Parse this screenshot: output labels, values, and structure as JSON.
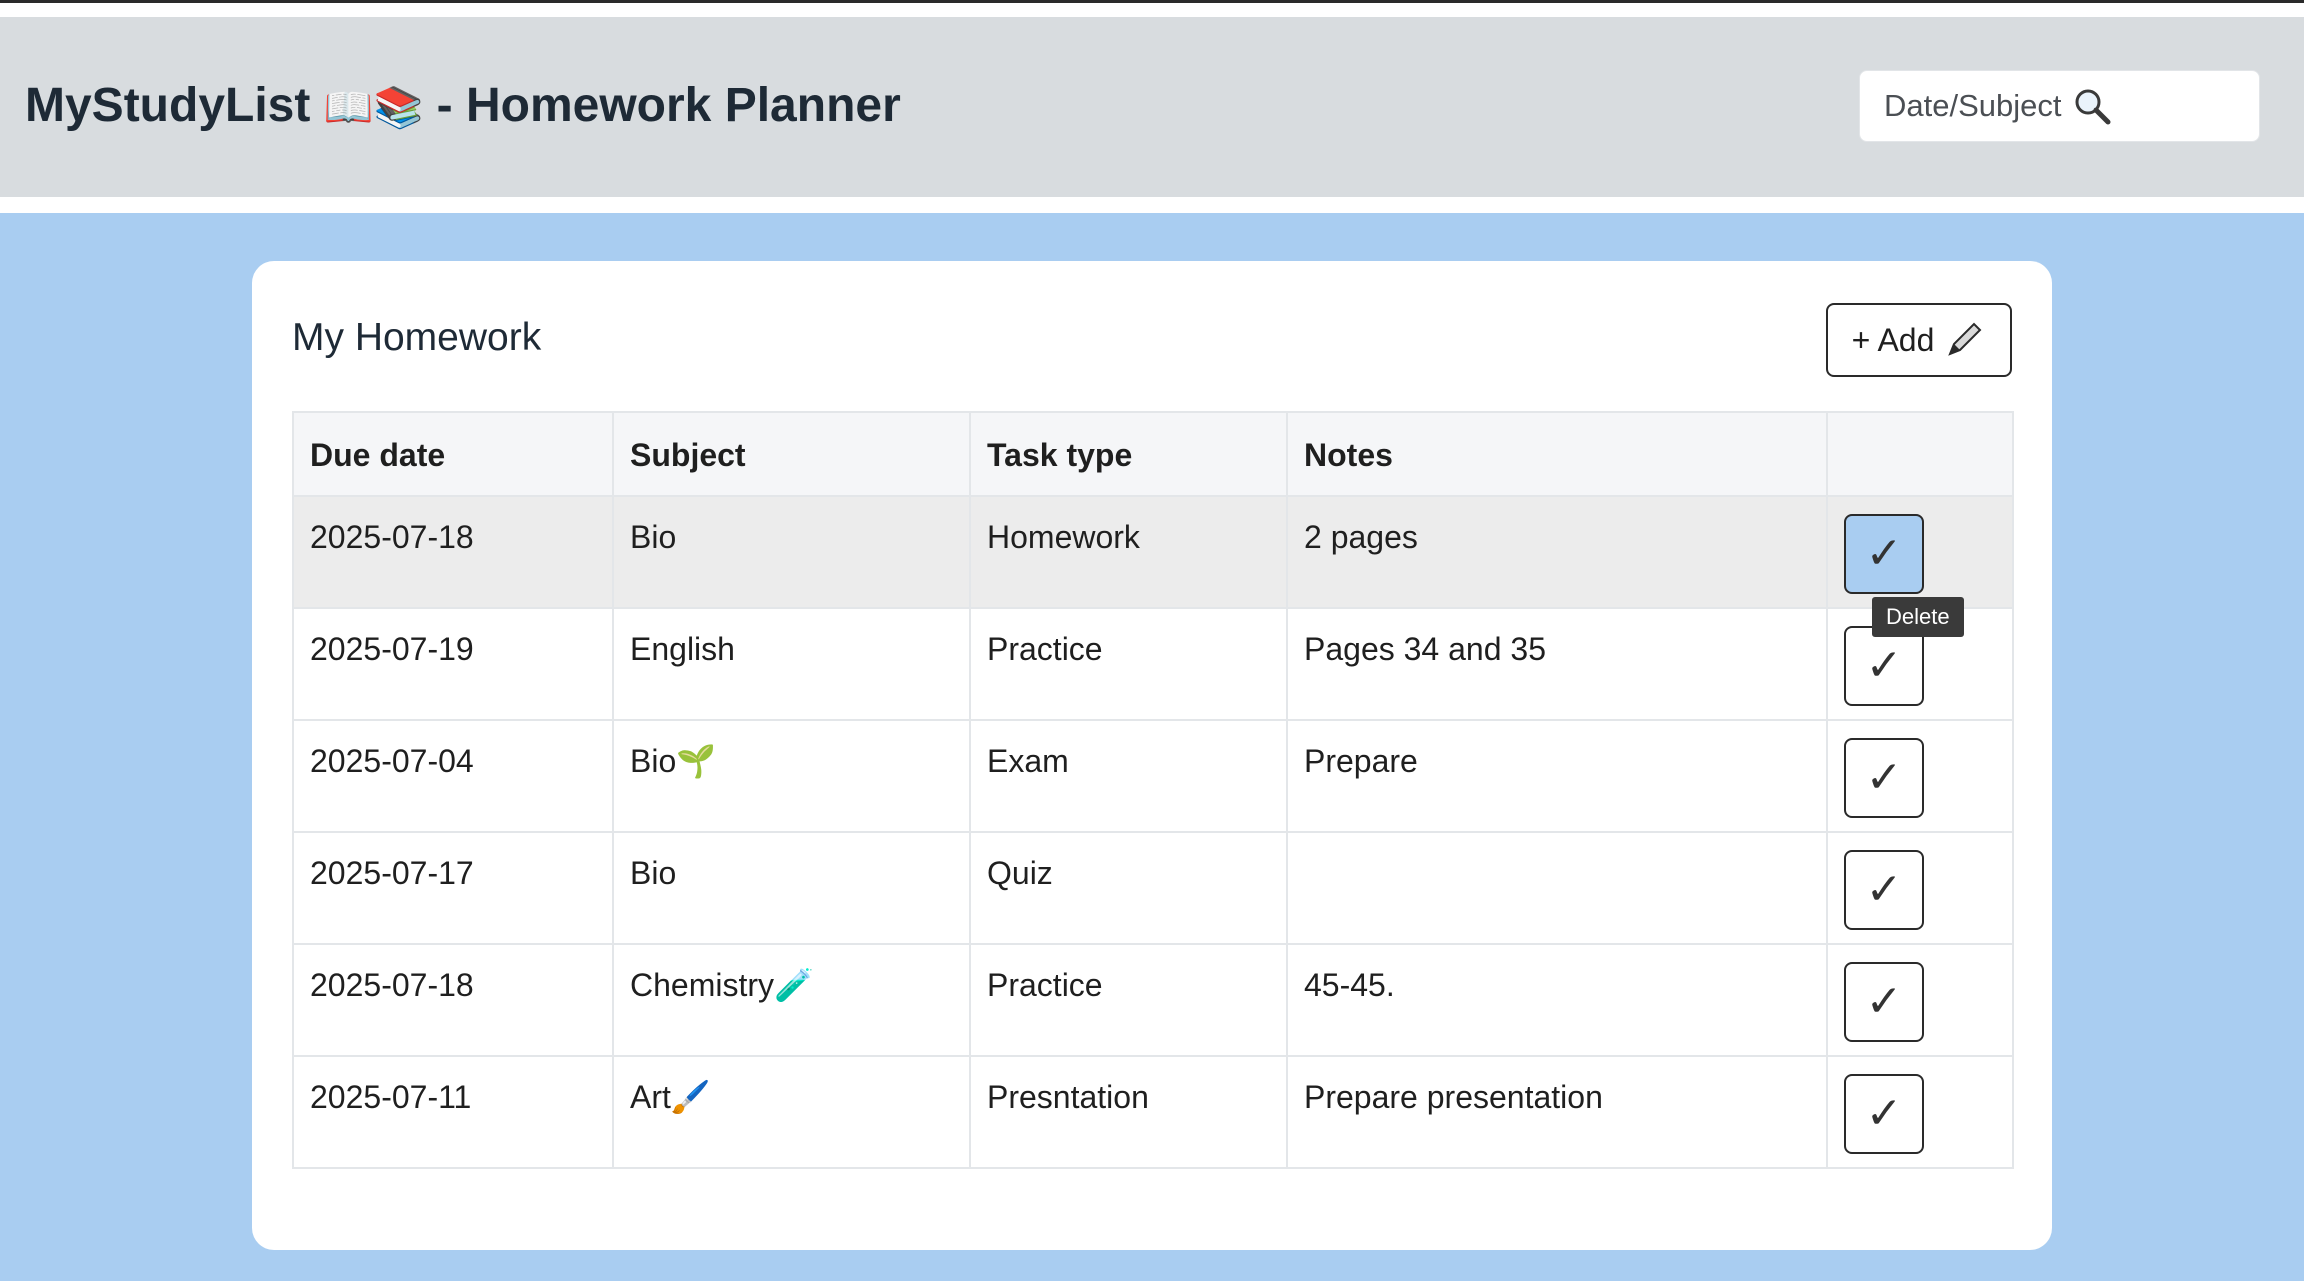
{
  "header": {
    "title_prefix": "MyStudyList",
    "title_emoji": "📖📚",
    "title_suffix": " - Homework Planner",
    "search_placeholder": "Date/Subject"
  },
  "card": {
    "title": "My Homework",
    "add_label": "+ Add"
  },
  "table": {
    "columns": [
      "Due date",
      "Subject",
      "Task type",
      "Notes",
      ""
    ],
    "rows": [
      {
        "due": "2025-07-18",
        "subject": "Bio",
        "type": "Homework",
        "notes": "2 pages"
      },
      {
        "due": "2025-07-19",
        "subject": "English",
        "type": "Practice",
        "notes": "Pages 34 and 35"
      },
      {
        "due": "2025-07-04",
        "subject": "Bio🌱",
        "type": "Exam",
        "notes": "Prepare"
      },
      {
        "due": "2025-07-17",
        "subject": "Bio",
        "type": "Quiz",
        "notes": ""
      },
      {
        "due": "2025-07-18",
        "subject": "Chemistry🧪",
        "type": "Practice",
        "notes": "45-45."
      },
      {
        "due": "2025-07-11",
        "subject": "Art🖌️",
        "type": "Presntation",
        "notes": "Prepare presentation"
      }
    ],
    "check_glyph": "✓"
  },
  "tooltip": "Delete",
  "colors": {
    "page_bg": "#a9cdf1",
    "header_bg": "#d8dcdf",
    "row_highlight": "#ececec",
    "tooltip_bg": "#3a3a3a"
  }
}
